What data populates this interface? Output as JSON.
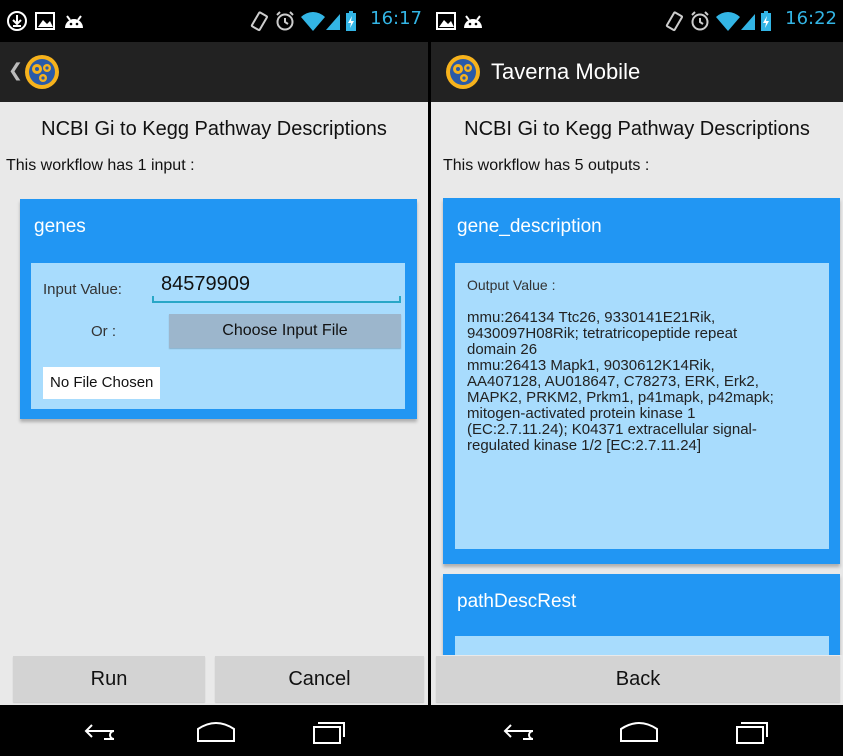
{
  "left": {
    "statusbar": {
      "time": "16:17"
    },
    "page": {
      "title": "NCBI Gi to Kegg Pathway Descriptions",
      "subtitle": "This workflow has 1 input :"
    },
    "input_card": {
      "name": "genes",
      "input_label": "Input Value:",
      "input_value": "84579909",
      "or_label": "Or :",
      "choose_button": "Choose Input File",
      "file_status": "No File Chosen"
    },
    "buttons": {
      "run": "Run",
      "cancel": "Cancel"
    }
  },
  "right": {
    "statusbar": {
      "time": "16:22"
    },
    "actionbar": {
      "title": "Taverna Mobile"
    },
    "page": {
      "title": "NCBI Gi to Kegg Pathway Descriptions",
      "subtitle": "This workflow has 5 outputs :"
    },
    "outputs": [
      {
        "name": "gene_description",
        "label": "Output Value :",
        "value": "mmu:264134  Ttc26, 9330141E21Rik,\n9430097H08Rik; tetratricopeptide repeat\ndomain 26\nmmu:26413 Mapk1, 9030612K14Rik,\nAA407128, AU018647, C78273, ERK, Erk2,\nMAPK2, PRKM2, Prkm1, p41mapk, p42mapk;\nmitogen-activated protein kinase 1\n(EC:2.7.11.24); K04371 extracellular signal-\nregulated kinase 1/2 [EC:2.7.11.24]"
      },
      {
        "name": "pathDescRest"
      }
    ],
    "buttons": {
      "back": "Back"
    }
  },
  "colors": {
    "card": "#2196f3",
    "card_inner": "#a8dcfd",
    "accent": "#33b5e5",
    "background": "#e9e9e9"
  }
}
